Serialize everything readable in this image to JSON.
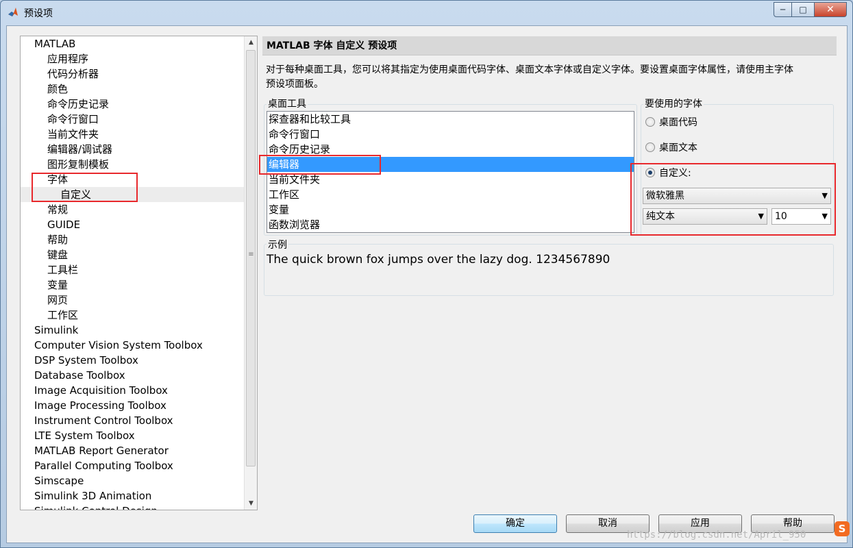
{
  "window": {
    "title": "预设项"
  },
  "tree": {
    "items": [
      {
        "label": "MATLAB",
        "level": 0
      },
      {
        "label": "应用程序",
        "level": 1
      },
      {
        "label": "代码分析器",
        "level": 1
      },
      {
        "label": "颜色",
        "level": 1
      },
      {
        "label": "命令历史记录",
        "level": 1
      },
      {
        "label": "命令行窗口",
        "level": 1
      },
      {
        "label": "当前文件夹",
        "level": 1
      },
      {
        "label": "编辑器/调试器",
        "level": 1
      },
      {
        "label": "图形复制模板",
        "level": 1
      },
      {
        "label": "字体",
        "level": 1
      },
      {
        "label": "自定义",
        "level": 2,
        "selected": true
      },
      {
        "label": "常规",
        "level": 1
      },
      {
        "label": "GUIDE",
        "level": 1
      },
      {
        "label": "帮助",
        "level": 1
      },
      {
        "label": "键盘",
        "level": 1
      },
      {
        "label": "工具栏",
        "level": 1
      },
      {
        "label": "变量",
        "level": 1
      },
      {
        "label": "网页",
        "level": 1
      },
      {
        "label": "工作区",
        "level": 1
      },
      {
        "label": "Simulink",
        "level": 0
      },
      {
        "label": "Computer Vision System Toolbox",
        "level": 0
      },
      {
        "label": "DSP System Toolbox",
        "level": 0
      },
      {
        "label": "Database Toolbox",
        "level": 0
      },
      {
        "label": "Image Acquisition Toolbox",
        "level": 0
      },
      {
        "label": "Image Processing Toolbox",
        "level": 0
      },
      {
        "label": "Instrument Control Toolbox",
        "level": 0
      },
      {
        "label": "LTE System Toolbox",
        "level": 0
      },
      {
        "label": "MATLAB Report Generator",
        "level": 0
      },
      {
        "label": "Parallel Computing Toolbox",
        "level": 0
      },
      {
        "label": "Simscape",
        "level": 0
      },
      {
        "label": "Simulink 3D Animation",
        "level": 0
      },
      {
        "label": "Simulink Control Design",
        "level": 0
      }
    ]
  },
  "panel": {
    "header": "MATLAB 字体 自定义 预设项",
    "description_line1": "对于每种桌面工具，您可以将其指定为使用桌面代码字体、桌面文本字体或自定义字体。要设置桌面字体属性，请使用主字体",
    "description_line2": "预设项面板。",
    "desktop_tools_label": "桌面工具",
    "desktop_tools": [
      {
        "label": "探查器和比较工具"
      },
      {
        "label": "命令行窗口"
      },
      {
        "label": "命令历史记录"
      },
      {
        "label": "编辑器",
        "selected": true
      },
      {
        "label": "当前文件夹"
      },
      {
        "label": "工作区"
      },
      {
        "label": "变量"
      },
      {
        "label": "函数浏览器"
      }
    ],
    "font_to_use_label": "要使用的字体",
    "radio_code_font": "桌面代码",
    "radio_text_font": "桌面文本",
    "radio_custom": "自定义:",
    "selected_radio": "custom",
    "font_name": "微软雅黑",
    "font_style": "纯文本",
    "font_size": "10",
    "sample_label": "示例",
    "sample_text": "The quick brown fox jumps over the lazy dog.  1234567890"
  },
  "buttons": {
    "ok": "确定",
    "cancel": "取消",
    "apply": "应用",
    "help": "帮助"
  },
  "watermark": "https://blog.csdn.net/April_950",
  "colors": {
    "selection": "#3399ff",
    "highlight_box": "#e8282c"
  }
}
